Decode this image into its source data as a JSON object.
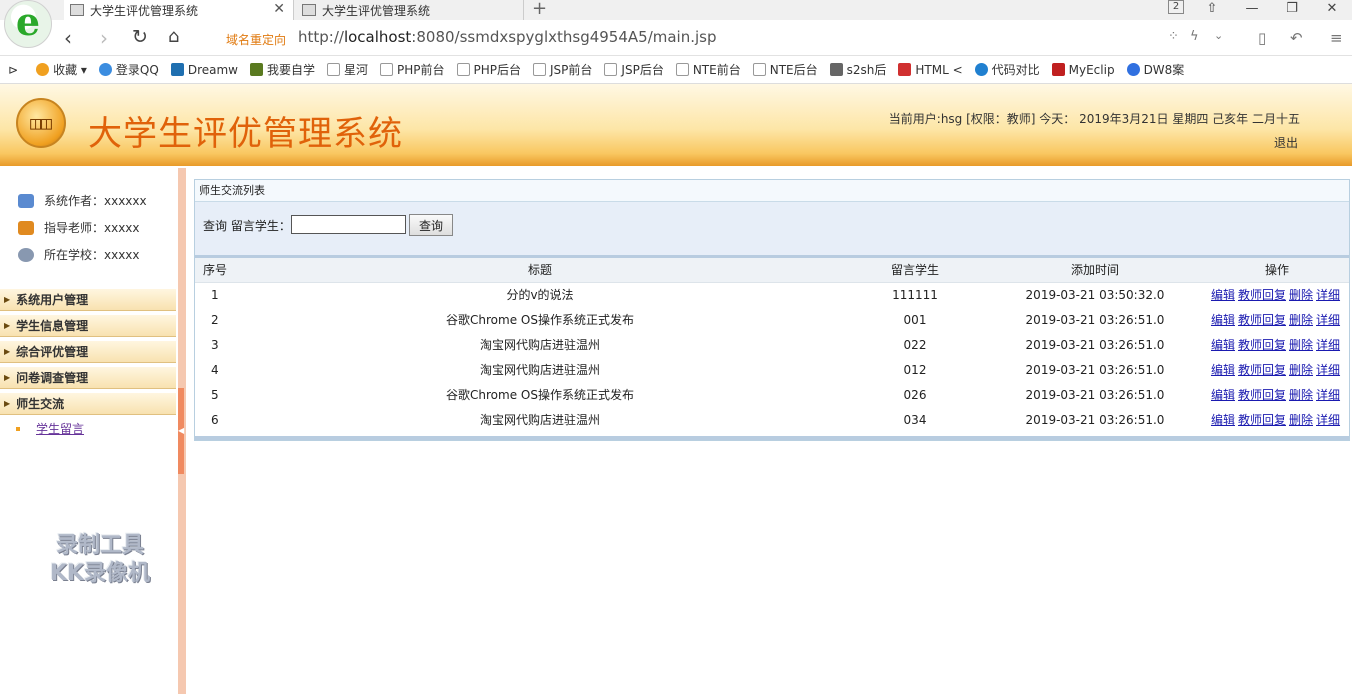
{
  "browser": {
    "tabs": [
      {
        "title": "大学生评优管理系统",
        "active": true
      },
      {
        "title": "大学生评优管理系统",
        "active": false
      }
    ],
    "tab_count": "2",
    "redirect_label": "域名重定向",
    "url_prefix": "http://",
    "url_host": "localhost",
    "url_rest": ":8080/ssmdxspyglxthsg4954A5/main.jsp",
    "bookmarks": [
      {
        "label": "收藏",
        "icon": "star-icon",
        "color": "#f0a020"
      },
      {
        "label": "登录QQ",
        "icon": "qq-icon",
        "color": "#3b8de0"
      },
      {
        "label": "Dreamw",
        "icon": "dreamweaver-icon",
        "color": "#1f6fb0"
      },
      {
        "label": "我要自学",
        "icon": "page-icon",
        "color": "#5a7a20"
      },
      {
        "label": "星河",
        "icon": "page-icon",
        "color": "#bbbbbb"
      },
      {
        "label": "PHP前台",
        "icon": "page-icon",
        "color": "#bbbbbb"
      },
      {
        "label": "PHP后台",
        "icon": "page-icon",
        "color": "#bbbbbb"
      },
      {
        "label": "JSP前台",
        "icon": "page-icon",
        "color": "#bbbbbb"
      },
      {
        "label": "JSP后台",
        "icon": "page-icon",
        "color": "#bbbbbb"
      },
      {
        "label": "NTE前台",
        "icon": "page-icon",
        "color": "#bbbbbb"
      },
      {
        "label": "NTE后台",
        "icon": "page-icon",
        "color": "#bbbbbb"
      },
      {
        "label": "s2sh后",
        "icon": "image-icon",
        "color": "#666666"
      },
      {
        "label": "HTML <",
        "icon": "html5-icon",
        "color": "#d03030"
      },
      {
        "label": "代码对比",
        "icon": "compare-icon",
        "color": "#2080d0"
      },
      {
        "label": "MyEclip",
        "icon": "myeclipse-icon",
        "color": "#c02020"
      },
      {
        "label": "DW8案",
        "icon": "paw-icon",
        "color": "#3070e0"
      }
    ]
  },
  "header": {
    "title": "大学生评优管理系统",
    "user_info": "当前用户:hsg [权限：教师] 今天： 2019年3月21日 星期四 己亥年 二月十五",
    "logout": "退出"
  },
  "sidebar": {
    "info": [
      {
        "text": "系统作者：xxxxxx",
        "icon": "users-icon",
        "color": "#5a8ad0"
      },
      {
        "text": "指导老师：xxxxx",
        "icon": "teacher-icon",
        "color": "#e08a20"
      },
      {
        "text": "所在学校：xxxxx",
        "icon": "school-icon",
        "color": "#8898b0"
      }
    ],
    "menu": [
      {
        "label": "系统用户管理"
      },
      {
        "label": "学生信息管理"
      },
      {
        "label": "综合评优管理"
      },
      {
        "label": "问卷调查管理"
      },
      {
        "label": "师生交流"
      }
    ],
    "sub_item": "学生留言",
    "watermark_line1": "录制工具",
    "watermark_line2": "KK录像机"
  },
  "main": {
    "panel_title": "师生交流列表",
    "search_label": "查询 留言学生：",
    "search_value": "",
    "search_button": "查询",
    "columns": [
      "序号",
      "标题",
      "留言学生",
      "添加时间",
      "操作"
    ],
    "ops": [
      "编辑",
      "教师回复",
      "删除",
      "详细"
    ],
    "rows": [
      {
        "no": "1",
        "title": "分的v的说法",
        "student": "111111",
        "time": "2019-03-21 03:50:32.0"
      },
      {
        "no": "2",
        "title": "谷歌Chrome OS操作系统正式发布",
        "student": "001",
        "time": "2019-03-21 03:26:51.0"
      },
      {
        "no": "3",
        "title": "淘宝网代购店进驻温州",
        "student": "022",
        "time": "2019-03-21 03:26:51.0"
      },
      {
        "no": "4",
        "title": "淘宝网代购店进驻温州",
        "student": "012",
        "time": "2019-03-21 03:26:51.0"
      },
      {
        "no": "5",
        "title": "谷歌Chrome OS操作系统正式发布",
        "student": "026",
        "time": "2019-03-21 03:26:51.0"
      },
      {
        "no": "6",
        "title": "淘宝网代购店进驻温州",
        "student": "034",
        "time": "2019-03-21 03:26:51.0"
      }
    ]
  }
}
